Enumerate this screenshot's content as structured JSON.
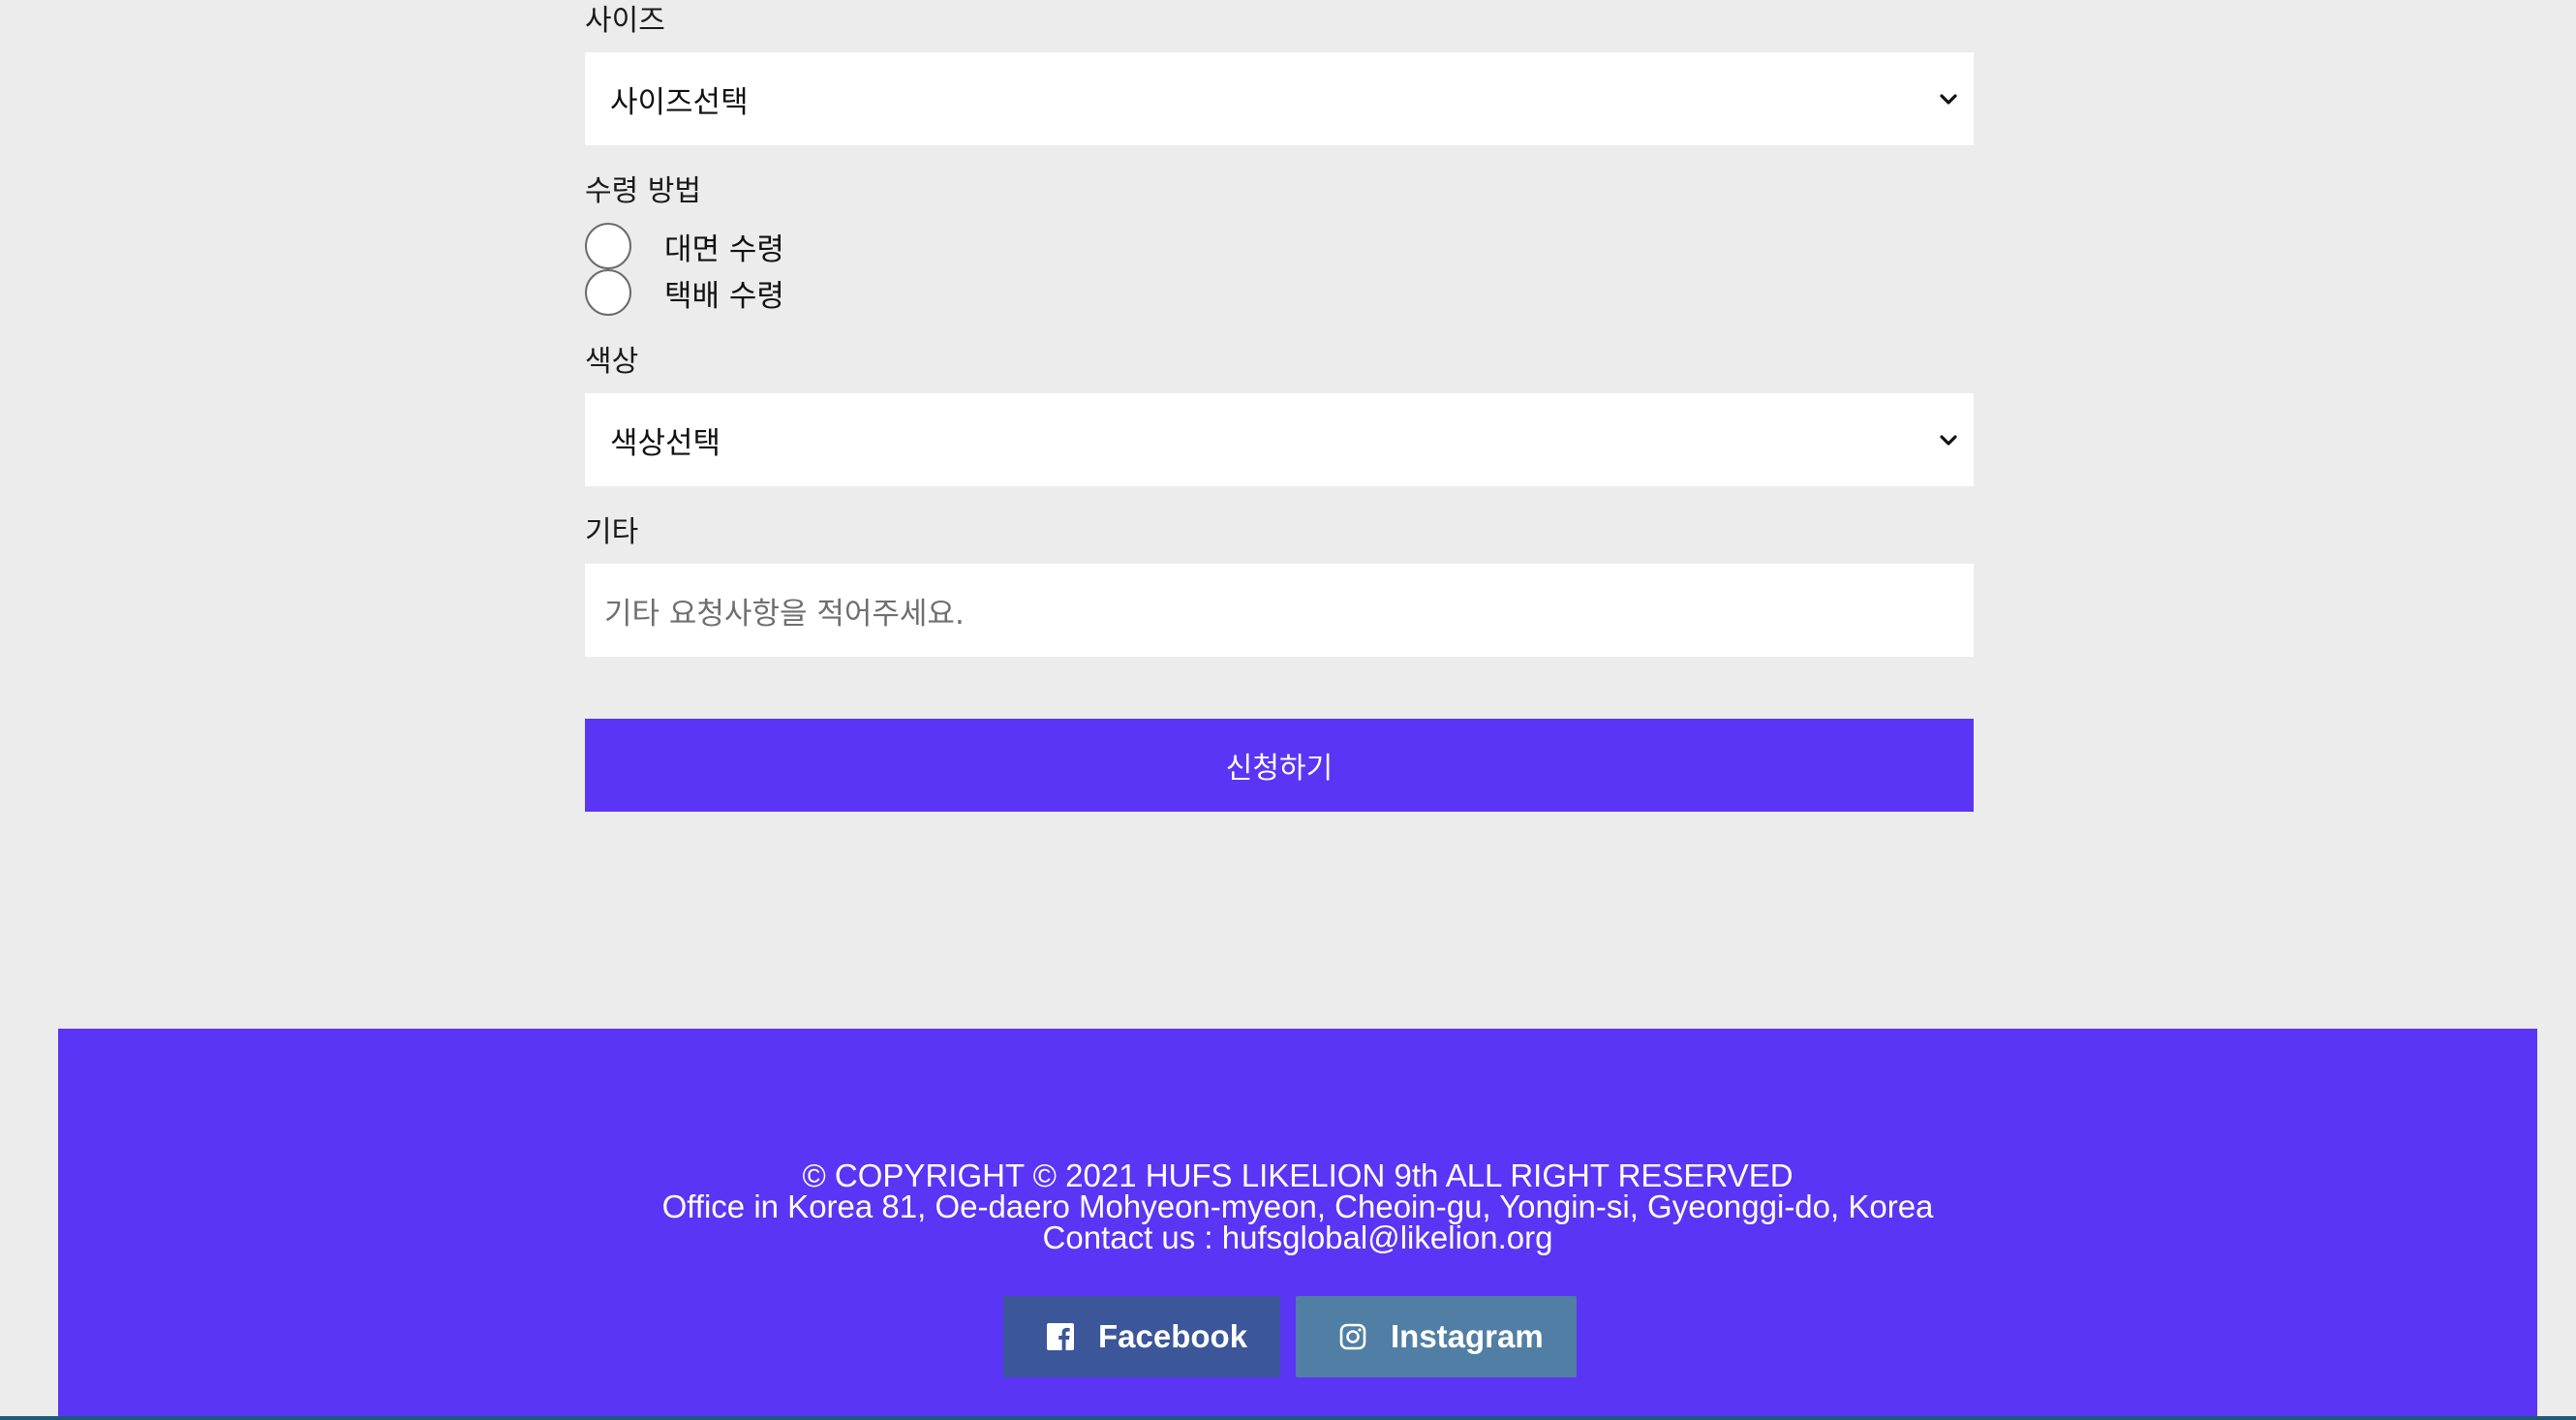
{
  "form": {
    "size_label": "사이즈",
    "size_select_value": "사이즈선택",
    "pickup_label": "수령 방법",
    "pickup_options": [
      "대면 수령",
      "택배 수령"
    ],
    "color_label": "색상",
    "color_select_value": "색상선택",
    "etc_label": "기타",
    "etc_placeholder": "기타 요청사항을 적어주세요.",
    "submit_label": "신청하기"
  },
  "footer": {
    "copyright": "© COPYRIGHT © 2021 HUFS LIKELION 9th ALL RIGHT RESERVED",
    "address": "Office in Korea 81, Oe-daero Mohyeon-myeon, Cheoin-gu, Yongin-si, Gyeonggi-do, Korea",
    "contact": "Contact us : hufsglobal@likelion.org",
    "facebook_label": "Facebook",
    "instagram_label": "Instagram"
  },
  "colors": {
    "accent": "#5b35f5",
    "facebook": "#3b5699",
    "instagram": "#517ea4",
    "background": "#ececec"
  },
  "icons": {
    "select_chevron": "chevron-down-icon",
    "facebook": "facebook-icon",
    "instagram": "instagram-icon"
  }
}
